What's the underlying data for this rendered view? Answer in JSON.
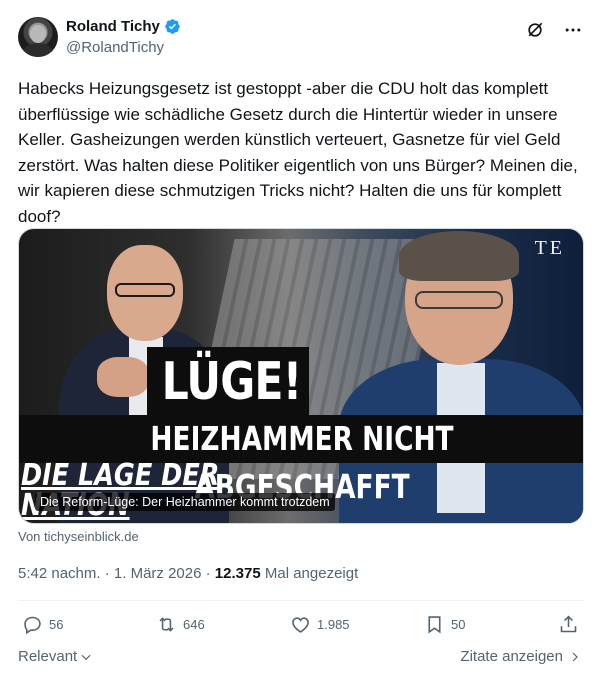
{
  "author": {
    "display_name": "Roland Tichy",
    "handle": "@RolandTichy",
    "verified": true,
    "verified_color": "#1d9bf0",
    "avatar_icon": "avatar-photo"
  },
  "header_icons": [
    "grok-icon",
    "more-icon"
  ],
  "tweet": {
    "text": "Habecks Heizungsgesetz ist gestoppt -aber die CDU holt das komplett überflüssige wie schädliche Gesetz durch die Hintertür wieder in unsere Keller. Gasheizungen werden künstlich verteuert, Gasnetze für viel Geld zerstört. Was halten diese Politiker eigentlich von uns Bürger? Meinen die, wir kapieren diese schmutzigen Tricks nicht? Halten die uns für komplett doof?"
  },
  "media": {
    "logo_text": "TE",
    "big_word": "LÜGE!",
    "headline": "HEIZHAMMER NICHT ABGESCHAFFT",
    "subline": "DIE LAGE DER NATION",
    "caption": "Die Reform-Lüge: Der Heizhammer kommt trotzdem",
    "source": "Von tichyseinblick.de"
  },
  "meta": {
    "time": "5:42 nachm.",
    "separator": "·",
    "date": "1. März 2026",
    "views": "12.375",
    "views_label": "Mal angezeigt"
  },
  "actions": {
    "replies": "56",
    "reposts": "646",
    "likes": "1.985",
    "bookmarks": "50",
    "icons": [
      "reply-icon",
      "repost-icon",
      "like-icon",
      "bookmark-icon",
      "share-icon"
    ]
  },
  "footer": {
    "sort_label": "Relevant",
    "quotes_label": "Zitate anzeigen"
  },
  "colors": {
    "text": "#0f1419",
    "secondary": "#536471",
    "accent": "#1d9bf0",
    "divider": "#eff3f4"
  }
}
